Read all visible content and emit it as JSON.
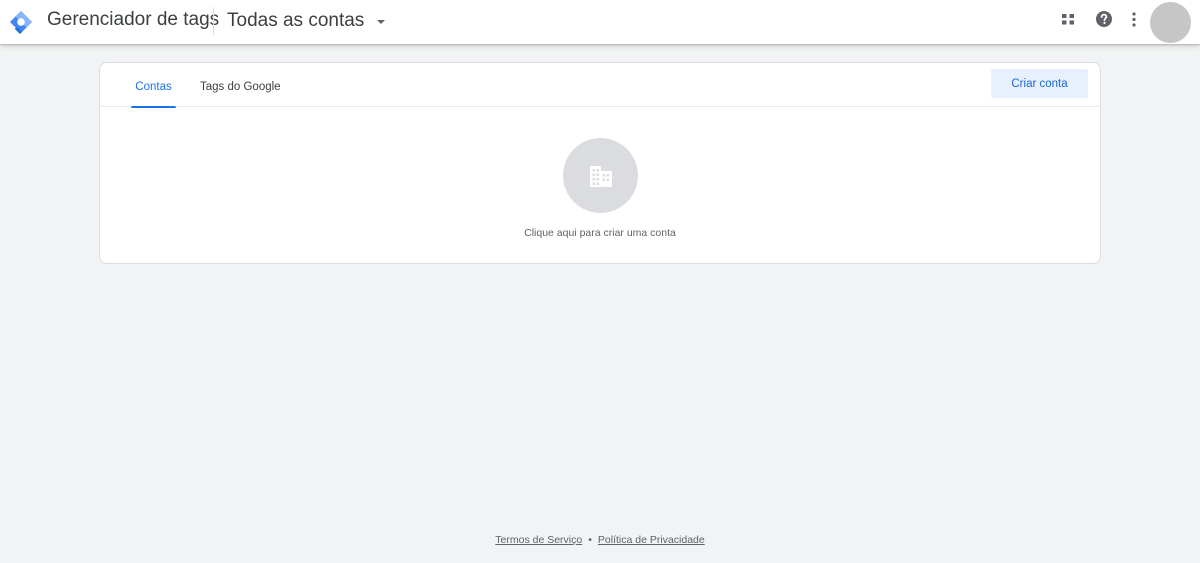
{
  "header": {
    "product_name": "Gerenciador de tags",
    "account_selector": "Todas as contas",
    "icons": [
      "tag-manager-logo",
      "apps-grid-icon",
      "help-icon",
      "more-vert-icon",
      "avatar"
    ]
  },
  "card": {
    "tabs": [
      {
        "label": "Contas",
        "active": true
      },
      {
        "label": "Tags do Google",
        "active": false
      }
    ],
    "create_button_label": "Criar conta",
    "empty_state": {
      "icon": "building-icon",
      "text": "Clique aqui para criar uma conta"
    }
  },
  "footer": {
    "terms": "Termos de Serviço",
    "separator": "•",
    "privacy": "Política de Privacidade"
  },
  "colors": {
    "accent": "#1a73e8",
    "background": "#f1f3f4",
    "button_bg": "#e8f0fe"
  }
}
